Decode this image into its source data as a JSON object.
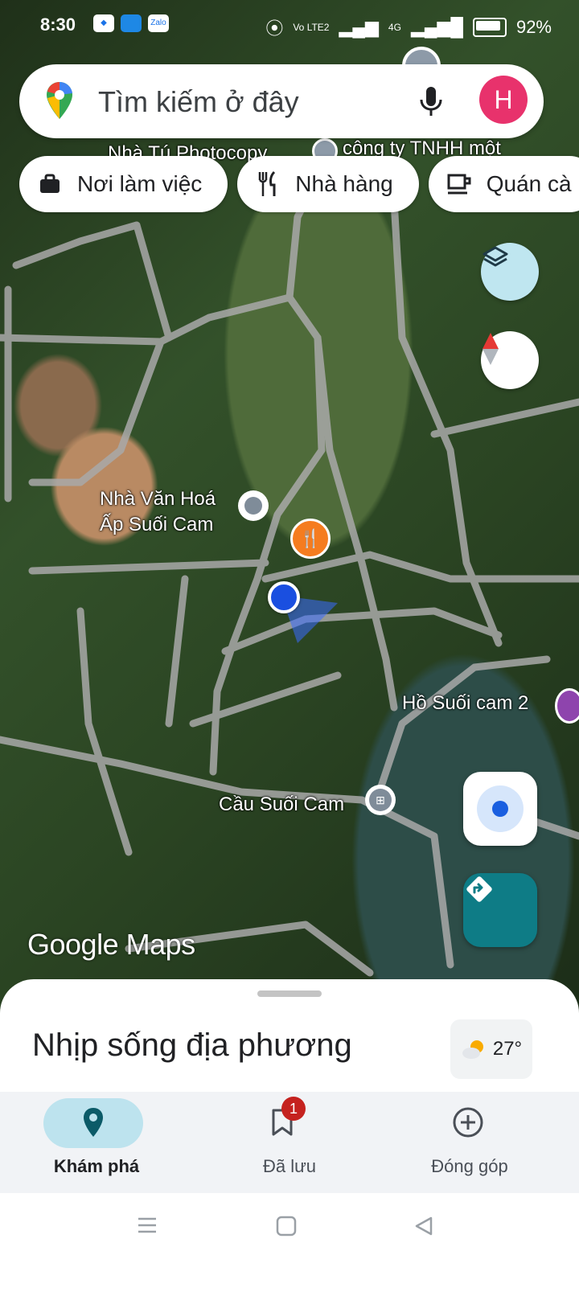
{
  "status_bar": {
    "time": "8:30",
    "app_icons": [
      "notification-app-icon",
      "browser-app-icon",
      "Zalo"
    ],
    "network_label": "Vo LTE2",
    "network_type": "4G",
    "battery": "92%"
  },
  "search": {
    "placeholder": "Tìm kiếm ở đây",
    "avatar_letter": "H",
    "avatar_color": "#e8326c"
  },
  "chips": [
    {
      "label": "Nơi làm việc",
      "icon": "briefcase-icon"
    },
    {
      "label": "Nhà hàng",
      "icon": "fork-knife-icon"
    },
    {
      "label": "Quán cà",
      "icon": "coffee-cup-icon"
    }
  ],
  "map": {
    "labels": {
      "photocopy": "Nhà Tú Photocopy",
      "company": "công ty TNHH một",
      "cultural_house_line1": "Nhà Văn Hoá",
      "cultural_house_line2": "Ấp Suối Cam",
      "lake": "Hồ Suối cam 2",
      "bridge": "Cầu Suối Cam"
    },
    "watermark": "Google Maps",
    "location_dot_color": "#1a4fe0",
    "directions_color": "#0e7c86"
  },
  "sheet": {
    "title": "Nhịp sống địa phương",
    "temperature": "27°"
  },
  "bottom_nav": [
    {
      "label": "Khám phá",
      "icon": "explore-pin-icon",
      "active": true
    },
    {
      "label": "Đã lưu",
      "icon": "bookmark-icon",
      "badge": "1"
    },
    {
      "label": "Đóng góp",
      "icon": "add-circle-icon"
    }
  ]
}
